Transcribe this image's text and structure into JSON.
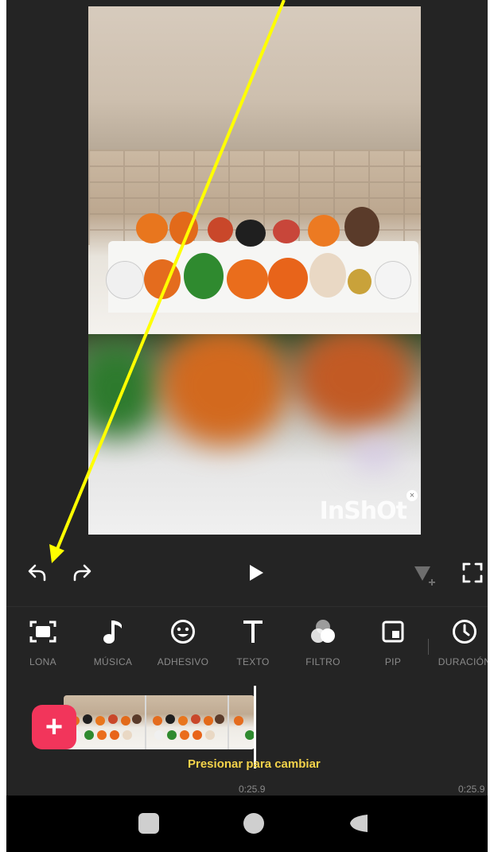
{
  "watermark": {
    "text": "InShOt"
  },
  "controls": {
    "undo_icon": "undo-icon",
    "redo_icon": "redo-icon",
    "play_icon": "play-icon",
    "keyframe_icon": "keyframe-icon",
    "fullscreen_icon": "fullscreen-icon"
  },
  "toolbar": {
    "items": [
      {
        "label": "LONA",
        "icon": "canvas-icon"
      },
      {
        "label": "MÚSICA",
        "icon": "music-icon"
      },
      {
        "label": "ADHESIVO",
        "icon": "sticker-icon"
      },
      {
        "label": "TEXTO",
        "icon": "text-icon"
      },
      {
        "label": "FILTRO",
        "icon": "filter-icon"
      },
      {
        "label": "PIP",
        "icon": "pip-icon"
      },
      {
        "label": "DURACIÓN",
        "icon": "clock-icon"
      }
    ]
  },
  "timeline": {
    "hint": "Presionar para cambiar",
    "current_time": "0:25.9",
    "total_time": "0:25.9",
    "add_label": "+"
  },
  "annotation": {
    "color": "#ffff00"
  },
  "colors": {
    "add_button": "#f2355b",
    "hint_text": "#f4d34a",
    "background": "#242424"
  }
}
